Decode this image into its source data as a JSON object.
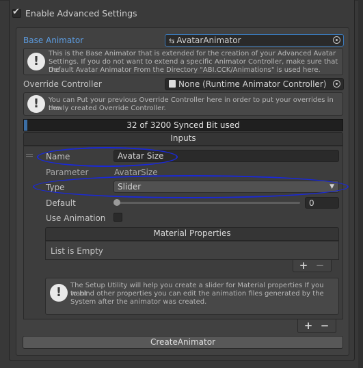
{
  "advanced": {
    "label": "Enable Advanced Settings",
    "checked": true
  },
  "base_animator": {
    "label": "Base Animator",
    "value": "AvatarAnimator",
    "help": [
      "This is the Base Animator that is extended for the creation of your Advanced Avatar",
      "Settings. If you do not want to extend a specific Animator Controller, make sure that the",
      "Default Avatar Animator From the Directory \"ABI.CCK/Animations\" is used here."
    ]
  },
  "override_controller": {
    "label": "Override Controller",
    "value": "None (Runtime Animator Controller)",
    "help": [
      "You can Put your previous Override Controller here in order to put your overrides in the",
      "newly created Override Controller."
    ]
  },
  "synced_bits": {
    "text": "32 of 3200 Synced Bit used",
    "used": 32,
    "total": 3200
  },
  "inputs": {
    "header": "Inputs",
    "entry": {
      "name_label": "Name",
      "name_value": "Avatar Size",
      "parameter_label": "Parameter",
      "parameter_value": "AvatarSize",
      "type_label": "Type",
      "type_value": "Slider",
      "default_label": "Default",
      "default_value": "0",
      "default_level": 0,
      "use_animation_label": "Use Animation",
      "use_animation_checked": false,
      "material_properties": {
        "header": "Material Properties",
        "empty_text": "List is Empty",
        "add": "+",
        "remove": "−"
      },
      "help": [
        "The Setup Utility will help you create a slider for Material properties If you want",
        "to bind other properties you can edit the animation files generated by the",
        "System after the animator was created."
      ]
    },
    "add": "+",
    "remove": "−"
  },
  "create_button": "CreateAnimator"
}
